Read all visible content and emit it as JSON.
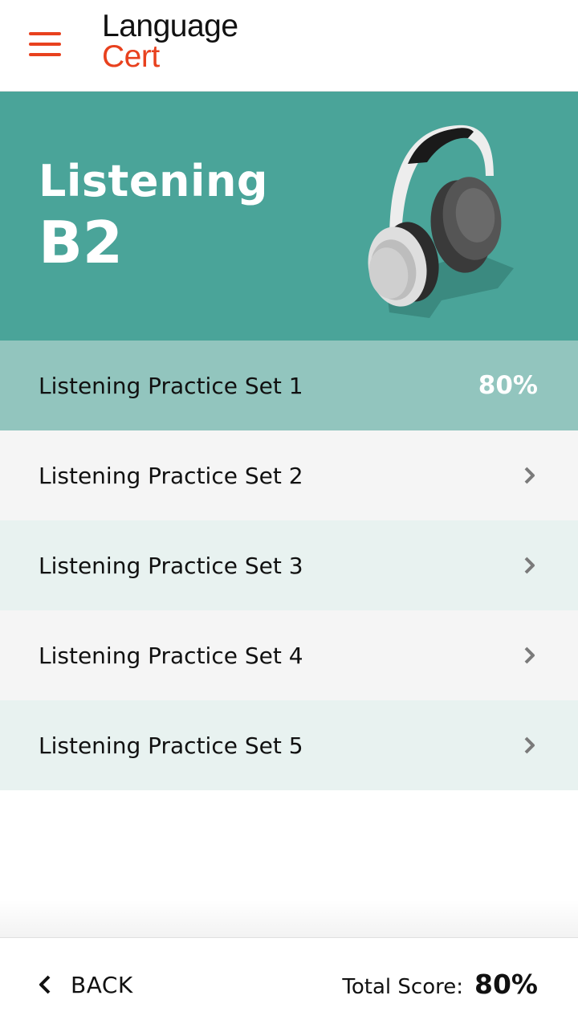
{
  "header": {
    "logo_line1": "Language",
    "logo_line2": "Cert",
    "menu_icon": "hamburger-menu-icon",
    "brand_color": "#e8411e"
  },
  "hero": {
    "title": "Listening",
    "level": "B2",
    "illustration": "headphones-icon",
    "background": "#4aa499"
  },
  "sets": [
    {
      "label": "Listening Practice Set 1",
      "score": "80%",
      "completed": true
    },
    {
      "label": "Listening Practice Set 2",
      "completed": false
    },
    {
      "label": "Listening Practice Set 3",
      "completed": false
    },
    {
      "label": "Listening Practice Set 4",
      "completed": false
    },
    {
      "label": "Listening Practice Set 5",
      "completed": false
    }
  ],
  "footer": {
    "back_label": "BACK",
    "total_label": "Total Score:",
    "total_value": "80%"
  }
}
